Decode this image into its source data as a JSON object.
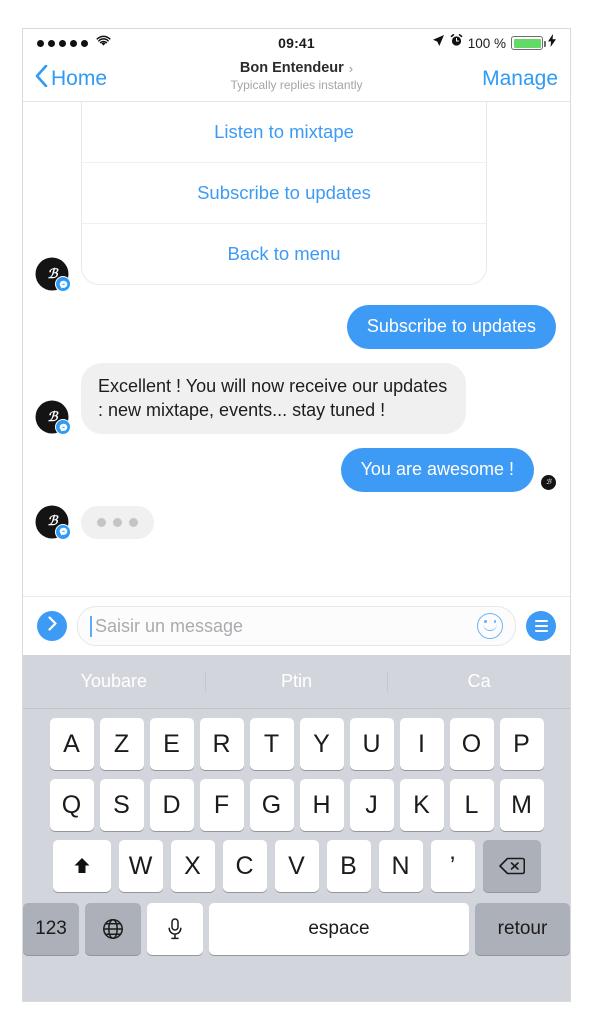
{
  "status_bar": {
    "signal_dots": 5,
    "wifi_icon": "wifi-icon",
    "time": "09:41",
    "location_icon": "location-arrow-icon",
    "alarm_icon": "alarm-clock-icon",
    "battery_percent": "100 %",
    "charging_icon": "lightning-bolt-icon",
    "battery_color": "#63da67"
  },
  "nav": {
    "back_label": "Home",
    "back_icon": "chevron-left-icon",
    "title": "Bon Entendeur",
    "title_chevron": "›",
    "subtitle": "Typically replies instantly",
    "action_label": "Manage"
  },
  "thread": {
    "avatar_monogram": "ℬ",
    "messenger_badge_icon": "messenger-badge-icon",
    "card": {
      "buttons": [
        {
          "label": "Listen to mixtape"
        },
        {
          "label": "Subscribe to updates"
        },
        {
          "label": "Back to menu"
        }
      ]
    },
    "messages": [
      {
        "side": "out",
        "type": "pill",
        "text": "Subscribe to updates"
      },
      {
        "side": "in",
        "type": "bubble",
        "text": "Excellent ! You will now receive our updates : new mixtape, events... stay tuned !"
      },
      {
        "side": "out",
        "type": "pill",
        "text": "You are awesome !",
        "seen": true
      },
      {
        "side": "in",
        "type": "typing",
        "text": ""
      }
    ],
    "bubble_in_color": "#f1f0f0",
    "bubble_out_color": "#3d9bf5",
    "link_color": "#3d9bf5"
  },
  "composer": {
    "send_icon": "chevron-right-icon",
    "placeholder": "Saisir un message",
    "value": "",
    "emoji_icon": "smiley-face-icon",
    "menu_icon": "hamburger-menu-icon"
  },
  "keyboard": {
    "suggestions": [
      "Youbare",
      "Ptin",
      "Ca"
    ],
    "row1": [
      "A",
      "Z",
      "E",
      "R",
      "T",
      "Y",
      "U",
      "I",
      "O",
      "P"
    ],
    "row2": [
      "Q",
      "S",
      "D",
      "F",
      "G",
      "H",
      "J",
      "K",
      "L",
      "M"
    ],
    "row3": [
      "W",
      "X",
      "C",
      "V",
      "B",
      "N",
      "’"
    ],
    "shift_icon": "shift-arrow-icon",
    "backspace_icon": "backspace-icon",
    "numeric_label": "123",
    "globe_icon": "globe-icon",
    "mic_icon": "microphone-icon",
    "space_label": "espace",
    "return_label": "retour",
    "background_color": "#d2d5db"
  }
}
